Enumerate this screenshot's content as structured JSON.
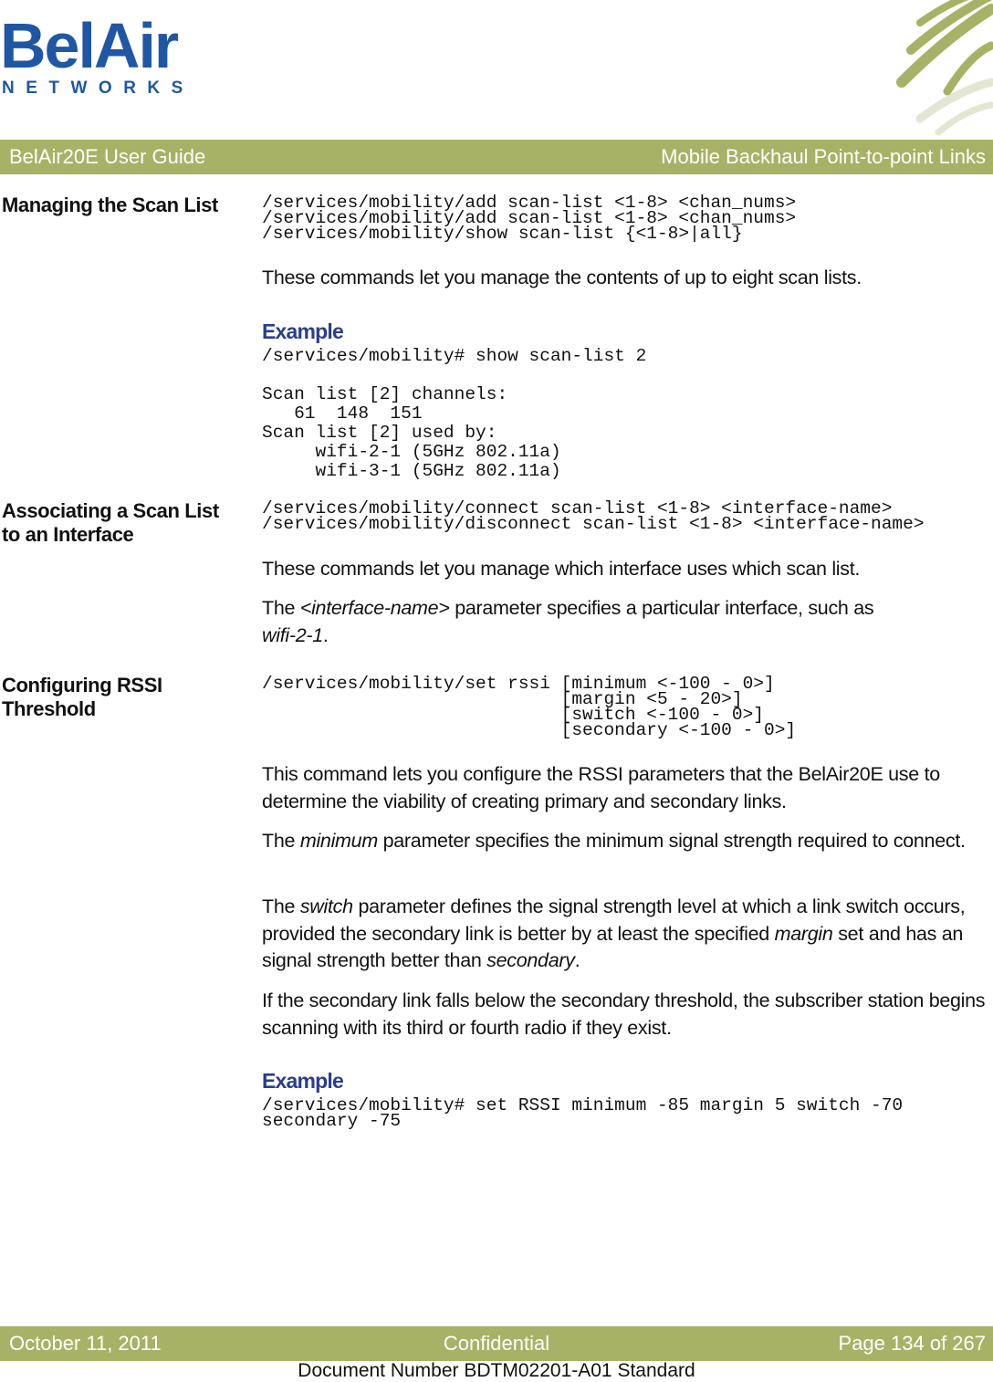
{
  "logo": {
    "brand": "BelAir",
    "subtitle": "NETWORKS"
  },
  "header": {
    "left": "BelAir20E User Guide",
    "right": "Mobile Backhaul Point-to-point Links"
  },
  "sections": {
    "scan_list": {
      "heading": "Managing the Scan List",
      "commands": [
        "/services/mobility/add scan-list <1-8> <chan_nums>",
        "/services/mobility/add scan-list <1-8> <chan_nums>",
        "/services/mobility/show scan-list {<1-8>|all}"
      ],
      "description": "These commands let you manage the contents of up to eight scan lists.",
      "example_heading": "Example",
      "example_lines": [
        "/services/mobility# show scan-list 2",
        "",
        "Scan list [2] channels:",
        "   61  148  151",
        "Scan list [2] used by:",
        "     wifi-2-1 (5GHz 802.11a)",
        "     wifi-3-1 (5GHz 802.11a)"
      ]
    },
    "associate": {
      "heading_line1": "Associating a Scan List",
      "heading_line2": "to an Interface",
      "commands": [
        "/services/mobility/connect scan-list <1-8> <interface-name>",
        "/services/mobility/disconnect scan-list <1-8> <interface-name>"
      ],
      "description": "These commands let you manage which interface uses which scan list.",
      "param_prefix": "The ",
      "param_name": "<interface-name>",
      "param_text": " parameter specifies a particular interface, such as",
      "param_example": "wifi-2-1",
      "param_end": "."
    },
    "rssi": {
      "heading_line1": "Configuring RSSI",
      "heading_line2": "Threshold",
      "commands": [
        "/services/mobility/set rssi [minimum <-100 - 0>]",
        "                            [margin <5 - 20>]",
        "                            [switch <-100 - 0>]",
        "                            [secondary <-100 - 0>]"
      ],
      "p1": "This command lets you configure the RSSI parameters that the BelAir20E use to determine the viability of creating primary and secondary links.",
      "p2_prefix": "The ",
      "p2_term": "minimum",
      "p2_text": " parameter specifies the minimum signal strength required to connect.",
      "p3_prefix": "The ",
      "p3_term": "switch",
      "p3_text1": " parameter defines the signal strength level at which a link switch occurs, provided the secondary link is better by at least the specified ",
      "p3_term2": "margin",
      "p3_text2": " set and has an signal strength better than ",
      "p3_term3": "secondary",
      "p3_end": ".",
      "p4": "If the secondary link falls below the secondary threshold, the subscriber station begins scanning with its third or fourth radio if they exist.",
      "example_heading": "Example",
      "example_lines": [
        "/services/mobility# set RSSI minimum -85 margin 5 switch -70",
        "secondary -75"
      ]
    }
  },
  "footer": {
    "date": "October 11, 2011",
    "classification": "Confidential",
    "page": "Page 134 of 267",
    "document_number": "Document Number BDTM02201-A01 Standard"
  },
  "colors": {
    "brand_blue": "#1f57a4",
    "bar_green": "#a8b266",
    "example_blue": "#2b3d8f"
  }
}
